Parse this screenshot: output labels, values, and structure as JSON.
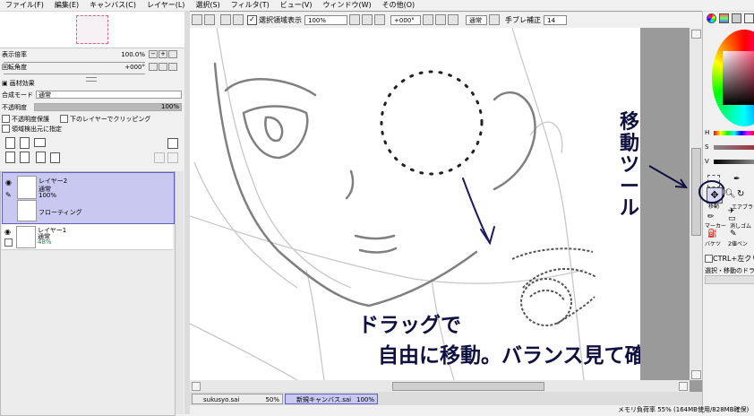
{
  "menu": [
    "ファイル(F)",
    "編集(E)",
    "キャンバス(C)",
    "レイヤー(L)",
    "選択(S)",
    "フィルタ(T)",
    "ビュー(V)",
    "ウィンドウ(W)",
    "その他(O)"
  ],
  "left": {
    "zoom_label": "表示倍率",
    "zoom_value": "100.0%",
    "angle_label": "回転角度",
    "angle_value": "+000°",
    "effects_label": "画材効果",
    "blend_label": "合成モード",
    "blend_value": "通常",
    "opacity_label": "不透明度",
    "opacity_value": "100%",
    "opacity_percent": 100,
    "check_protect": "不透明度保護",
    "check_clip": "下のレイヤーでクリッピング",
    "check_source": "領域検出元に指定",
    "layers": [
      {
        "name": "レイヤー2",
        "mode": "通常",
        "opacity": "100%",
        "floating": "フローティング"
      },
      {
        "name": "レイヤー1",
        "mode": "通常",
        "opacity": "48%"
      }
    ]
  },
  "toolbar": {
    "show_selection_label": "選択領域表示",
    "zoom": "100%",
    "angle": "+000°",
    "mode": "通常",
    "stabilizer_label": "手ブレ補正",
    "stabilizer": "14"
  },
  "docs": [
    {
      "name": "sukusyo.sai",
      "zoom": "50%"
    },
    {
      "name": "新規キャンバス.sai",
      "zoom": "100%"
    }
  ],
  "right": {
    "h": "H",
    "s": "S",
    "v": "V",
    "airbrush": "エアブラシ",
    "marker": "マーカー",
    "eraser": "消しゴム",
    "bucket": "バケツ",
    "doublepen": "2値ペン",
    "ctrl_label": "CTRL+左クリック",
    "select_move": "選択・移動のドラ",
    "move_tool": "移動"
  },
  "annotations": {
    "tool_name": "移動ツール",
    "instruction_line1": "ドラッグで",
    "instruction_line2": "自由に移動。バランス見て確定。"
  },
  "status": "メモリ負荷率 55% (164MB使用/828MB確保)"
}
